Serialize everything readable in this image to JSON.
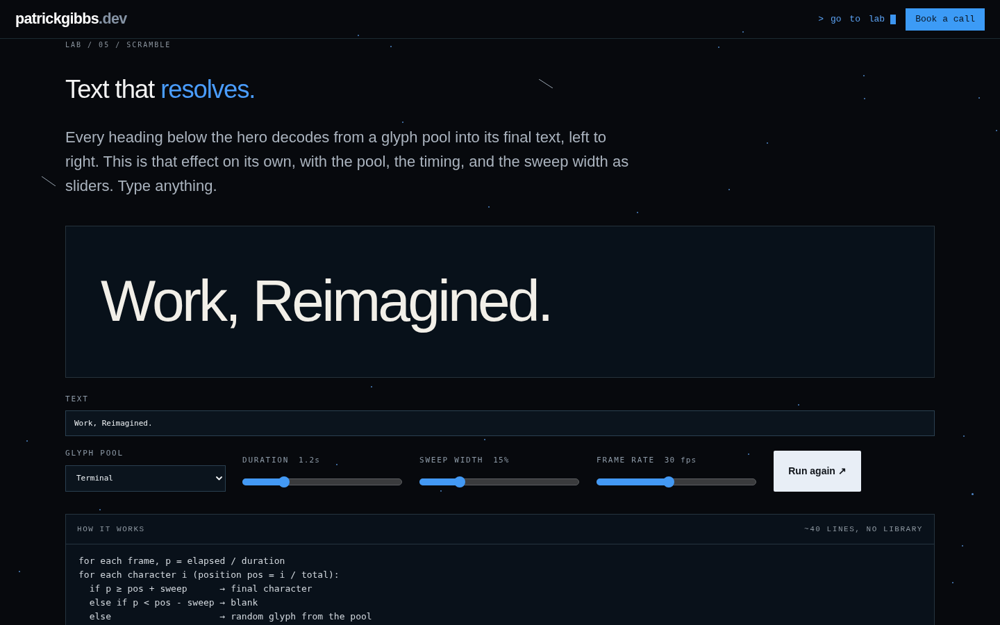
{
  "header": {
    "logo": {
      "name": "patrickgibbs",
      "suffix": ".dev"
    },
    "command": {
      "prompt": ">",
      "label": "go to lab"
    },
    "cta": "Book a call"
  },
  "breadcrumb": "LAB / 05 / SCRAMBLE",
  "hero": {
    "title": "Text that",
    "title_accent": "resolves.",
    "intro": "Every heading below the hero decodes from a glyph pool into its final text, left to right. This is that effect on its own, with the pool, the timing, and the sweep width as sliders. Type anything."
  },
  "preview": {
    "text": "Work, Reimagined."
  },
  "controls": {
    "text_field": {
      "label": "TEXT",
      "value": "Work, Reimagined."
    },
    "glyph_pool": {
      "label": "GLYPH POOL",
      "value": "Terminal"
    },
    "sliders": [
      {
        "label": "DURATION",
        "reading": "1.2s",
        "level": 0.26
      },
      {
        "label": "SWEEP WIDTH",
        "reading": "15%",
        "level": 0.25
      },
      {
        "label": "FRAME RATE",
        "reading": "30 fps",
        "level": 0.45
      }
    ],
    "run_button": "Run again ↗"
  },
  "how_it_works": {
    "title": "HOW IT WORKS",
    "note": "~40 LINES, NO LIBRARY",
    "code_lines": [
      "for each frame, p = elapsed / duration",
      "for each character i (position pos = i / total):",
      "  if p ≥ pos + sweep      → final character",
      "  else if p < pos - sweep → blank",
      "  else                    → random glyph from the pool"
    ]
  }
}
